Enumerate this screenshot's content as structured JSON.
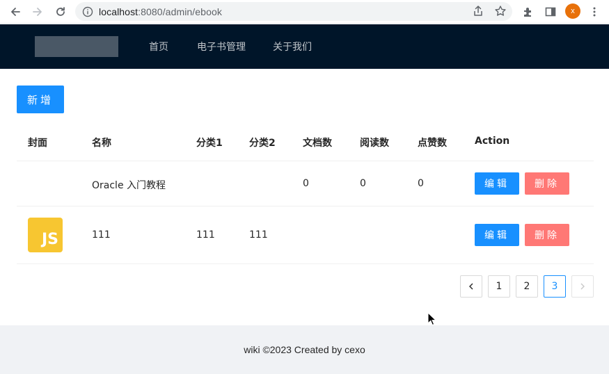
{
  "browser": {
    "url_host": "localhost",
    "url_rest": ":8080/admin/ebook",
    "profile_initial": "x"
  },
  "header": {
    "menu": [
      "首页",
      "电子书管理",
      "关于我们"
    ]
  },
  "toolbar": {
    "add_label": "新增"
  },
  "table": {
    "columns": [
      "封面",
      "名称",
      "分类1",
      "分类2",
      "文档数",
      "阅读数",
      "点赞数",
      "Action"
    ],
    "rows": [
      {
        "cover": "",
        "name": "Oracle 入门教程",
        "category1": "",
        "category2": "",
        "doc_count": "0",
        "view_count": "0",
        "vote_count": "0",
        "edit_label": "编辑",
        "delete_label": "删除"
      },
      {
        "cover": "JS",
        "name": "111",
        "category1": "111",
        "category2": "111",
        "doc_count": "",
        "view_count": "",
        "vote_count": "",
        "edit_label": "编辑",
        "delete_label": "删除"
      }
    ]
  },
  "pagination": {
    "prev": "<",
    "pages": [
      "1",
      "2",
      "3"
    ],
    "current": "3",
    "next": ">"
  },
  "footer": {
    "text": "wiki ©2023 Created by cexo"
  },
  "colors": {
    "header_bg": "#001529",
    "primary": "#1890ff",
    "danger": "#ff7875",
    "js_badge": "#f7c631",
    "footer_bg": "#f0f2f5"
  }
}
